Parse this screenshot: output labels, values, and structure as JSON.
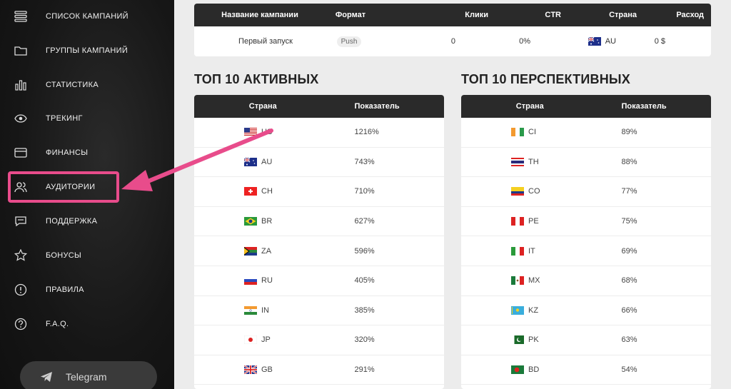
{
  "sidebar": {
    "items": [
      {
        "label": "СПИСОК КАМПАНИЙ",
        "icon": "list-icon"
      },
      {
        "label": "ГРУППЫ КАМПАНИЙ",
        "icon": "folder-icon"
      },
      {
        "label": "СТАТИСТИКА",
        "icon": "bar-chart-icon"
      },
      {
        "label": "ТРЕКИНГ",
        "icon": "eye-icon"
      },
      {
        "label": "ФИНАНСЫ",
        "icon": "card-icon"
      },
      {
        "label": "АУДИТОРИИ",
        "icon": "users-icon"
      },
      {
        "label": "ПОДДЕРЖКА",
        "icon": "chat-icon"
      },
      {
        "label": "БОНУСЫ",
        "icon": "star-icon"
      },
      {
        "label": "ПРАВИЛА",
        "icon": "info-icon"
      },
      {
        "label": "F.A.Q.",
        "icon": "question-icon"
      }
    ],
    "telegram_label": "Telegram"
  },
  "campaigns": {
    "headers": [
      "Название кампании",
      "Формат",
      "Клики",
      "CTR",
      "Страна",
      "Расход"
    ],
    "row": {
      "name": "Первый запуск",
      "format": "Push",
      "clicks": "0",
      "ctr": "0%",
      "country": "AU",
      "spend": "0 $"
    }
  },
  "top_active": {
    "title": "ТОП 10 АКТИВНЫХ",
    "headers": [
      "Страна",
      "Показатель"
    ],
    "rows": [
      {
        "country": "US",
        "value": "1216%"
      },
      {
        "country": "AU",
        "value": "743%"
      },
      {
        "country": "CH",
        "value": "710%"
      },
      {
        "country": "BR",
        "value": "627%"
      },
      {
        "country": "ZA",
        "value": "596%"
      },
      {
        "country": "RU",
        "value": "405%"
      },
      {
        "country": "IN",
        "value": "385%"
      },
      {
        "country": "JP",
        "value": "320%"
      },
      {
        "country": "GB",
        "value": "291%"
      }
    ]
  },
  "top_prospective": {
    "title": "ТОП 10 ПЕРСПЕКТИВНЫХ",
    "headers": [
      "Страна",
      "Показатель"
    ],
    "rows": [
      {
        "country": "CI",
        "value": "89%"
      },
      {
        "country": "TH",
        "value": "88%"
      },
      {
        "country": "CO",
        "value": "77%"
      },
      {
        "country": "PE",
        "value": "75%"
      },
      {
        "country": "IT",
        "value": "69%"
      },
      {
        "country": "MX",
        "value": "68%"
      },
      {
        "country": "KZ",
        "value": "66%"
      },
      {
        "country": "PK",
        "value": "63%"
      },
      {
        "country": "BD",
        "value": "54%"
      }
    ]
  },
  "colors": {
    "accent": "#e84c8b",
    "header_bg": "#2a2a2a",
    "sidebar_bg": "#161616"
  }
}
